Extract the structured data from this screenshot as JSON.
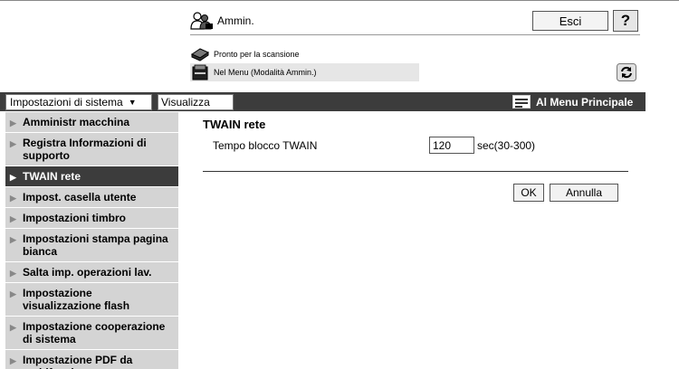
{
  "header": {
    "user_name": "Ammin.",
    "logout_label": "Esci",
    "help_label": "?",
    "status_ready": "Pronto per la scansione",
    "status_mode": "Nel Menu (Modalità Ammin.)"
  },
  "toolbar": {
    "system_select_value": "Impostazioni di sistema",
    "view_tab_label": "Visualizza",
    "main_menu_label": "Al Menu Principale"
  },
  "sidebar": {
    "items": [
      {
        "label": "Amministr macchina"
      },
      {
        "label": "Registra Informazioni di supporto"
      },
      {
        "label": "TWAIN rete"
      },
      {
        "label": "Impost. casella utente"
      },
      {
        "label": "Impostazioni timbro"
      },
      {
        "label": "Impostazioni stampa pagina bianca"
      },
      {
        "label": "Salta imp. operazioni lav."
      },
      {
        "label": "Impostazione visualizzazione flash"
      },
      {
        "label": "Impostazione cooperazione di sistema"
      },
      {
        "label": "Impostazione PDF da multifunzione"
      }
    ],
    "active_index": 2
  },
  "main": {
    "title": "TWAIN rete",
    "field_label": "Tempo blocco TWAIN",
    "field_value": "120",
    "field_unit": "sec(30-300)",
    "ok_label": "OK",
    "cancel_label": "Annulla"
  },
  "colors": {
    "toolbar_bg": "#3c3c3c",
    "sidebar_bg": "#d4d4d4",
    "sidebar_active_bg": "#3c3c3c"
  }
}
